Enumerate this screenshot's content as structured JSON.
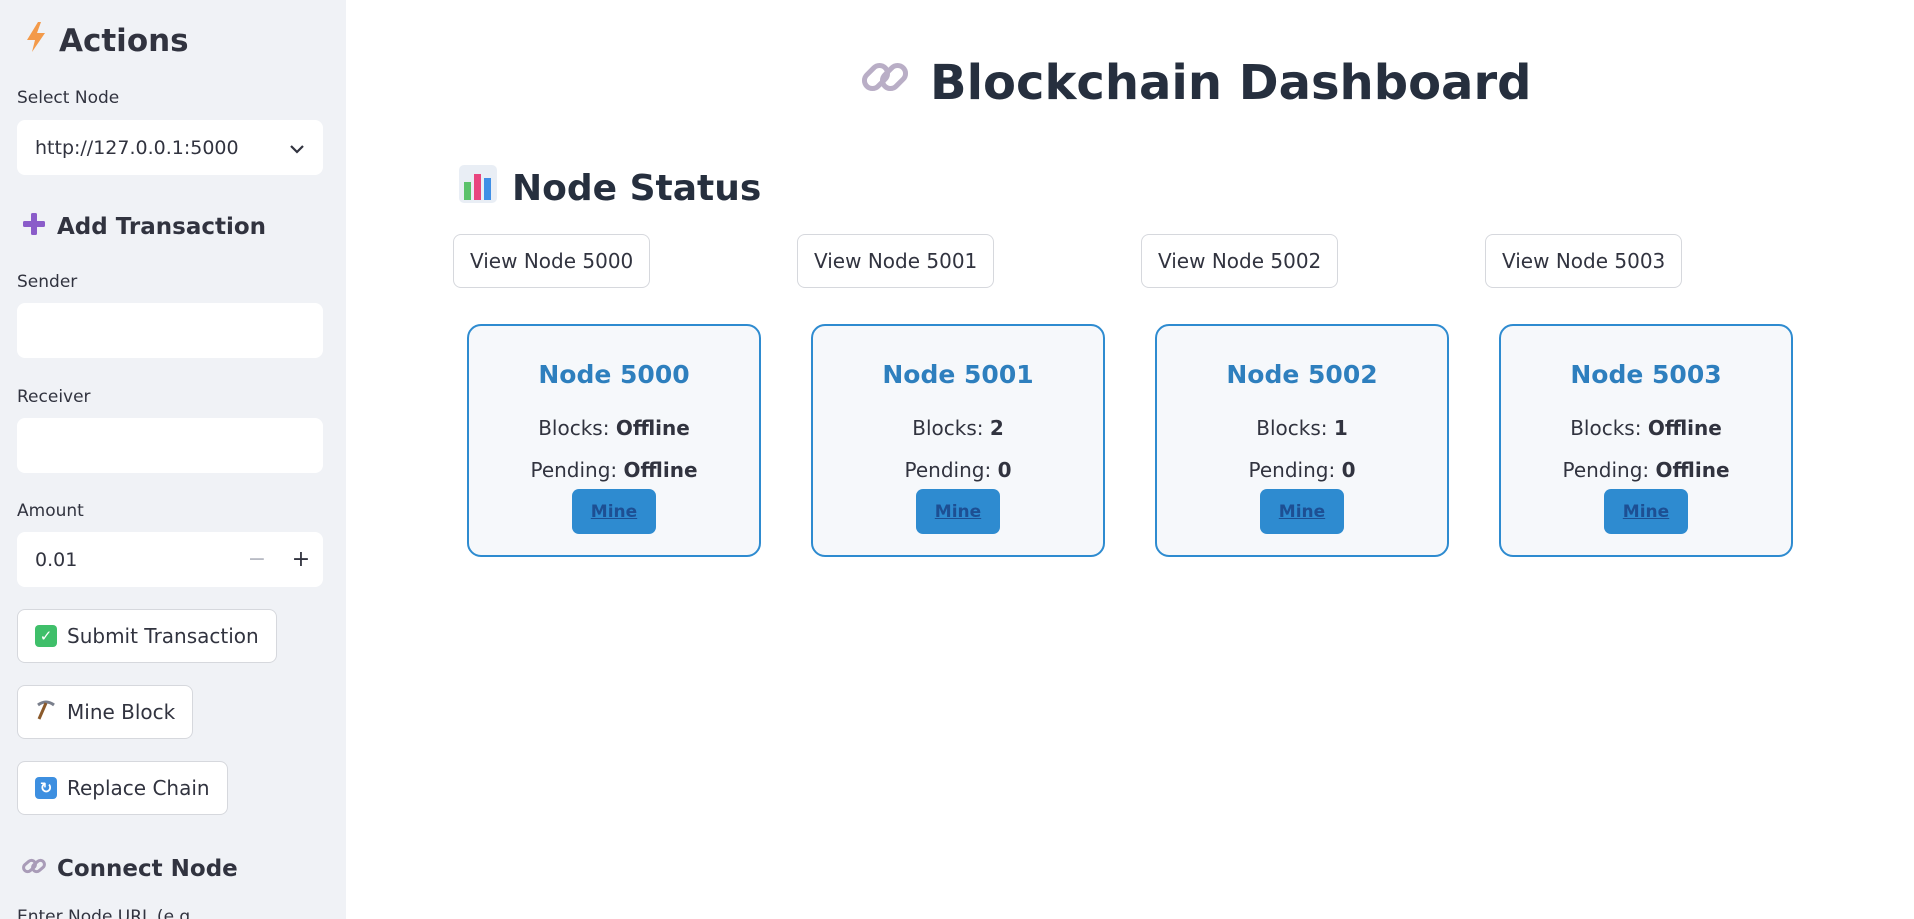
{
  "sidebar": {
    "title": "Actions",
    "select_node": {
      "label": "Select Node",
      "value": "http://127.0.0.1:5000"
    },
    "add_transaction": {
      "heading": "Add Transaction",
      "sender_label": "Sender",
      "sender_value": "",
      "receiver_label": "Receiver",
      "receiver_value": "",
      "amount_label": "Amount",
      "amount_value": "0.01",
      "minus": "−",
      "plus": "+"
    },
    "buttons": {
      "submit": "Submit Transaction",
      "mine": "Mine Block",
      "replace": "Replace Chain"
    },
    "connect_node": {
      "heading": "Connect Node",
      "label": "Enter Node URL (e.g."
    }
  },
  "main": {
    "title": "Blockchain Dashboard",
    "section_title": "Node Status",
    "view_buttons": [
      "View Node 5000",
      "View Node 5001",
      "View Node 5002",
      "View Node 5003"
    ],
    "blocks_label": "Blocks:",
    "pending_label": "Pending:",
    "nodes": [
      {
        "name": "Node 5000",
        "blocks": "Offline",
        "pending": "Offline",
        "mine": "Mine"
      },
      {
        "name": "Node 5001",
        "blocks": "2",
        "pending": "0",
        "mine": "Mine"
      },
      {
        "name": "Node 5002",
        "blocks": "1",
        "pending": "0",
        "mine": "Mine"
      },
      {
        "name": "Node 5003",
        "blocks": "Offline",
        "pending": "Offline",
        "mine": "Mine"
      }
    ]
  },
  "icons": {
    "actions": "lightning-icon",
    "add_transaction": "plus-icon",
    "submit": "check-icon",
    "mine": "pickaxe-icon",
    "replace": "refresh-icon",
    "connect": "link-icon",
    "title": "link-icon",
    "section": "bar-chart-icon",
    "select": "chevron-down-icon"
  },
  "colors": {
    "accent": "#2e8bd0",
    "card_title": "#2e7fbe",
    "sidebar_bg": "#f0f2f6"
  }
}
